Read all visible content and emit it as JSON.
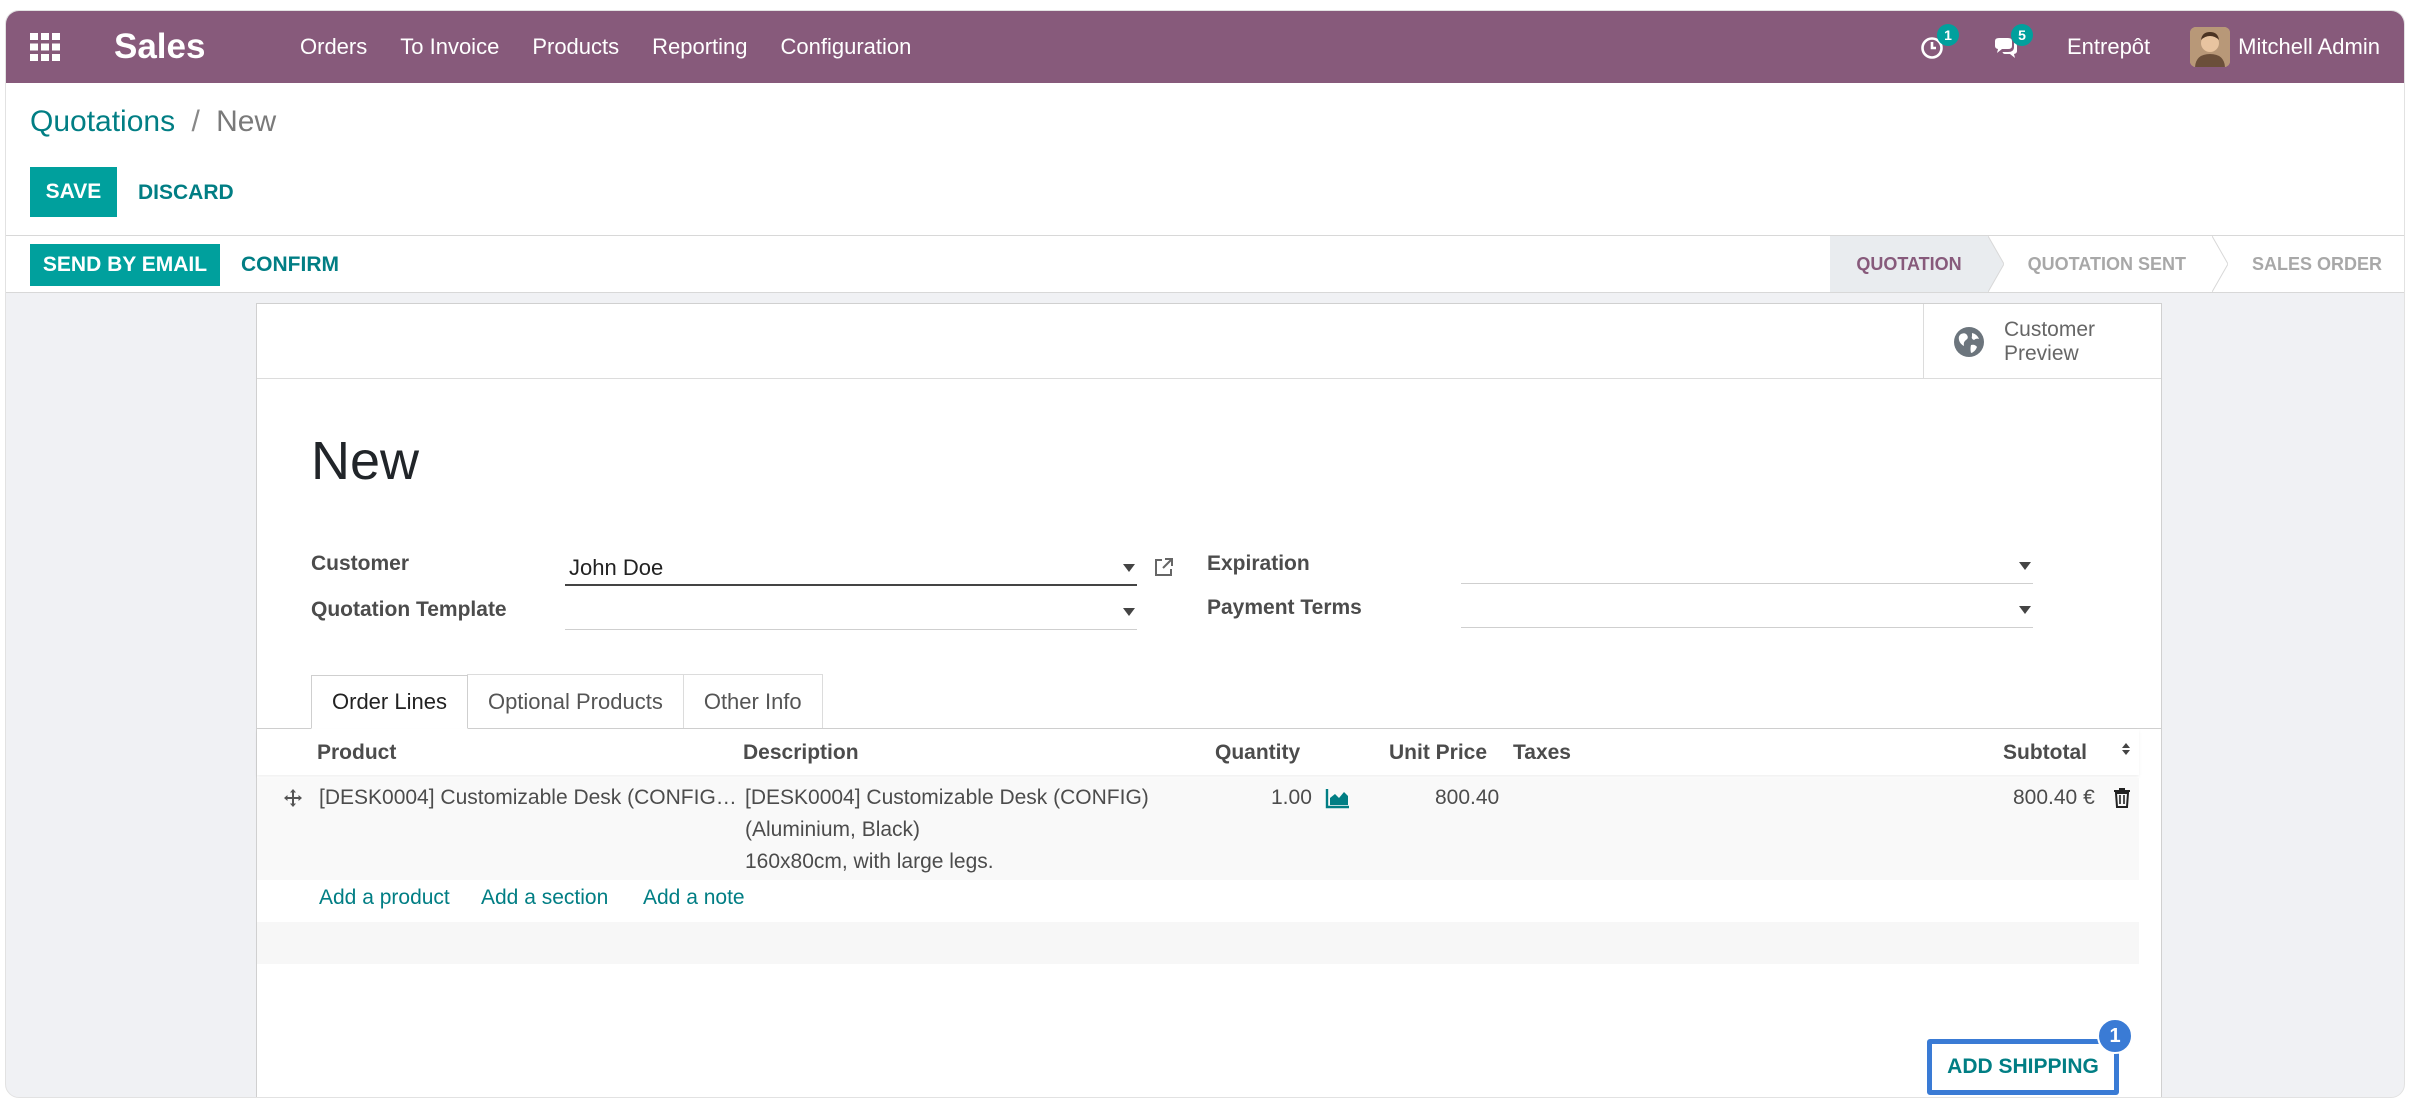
{
  "navbar": {
    "app_name": "Sales",
    "menu": [
      "Orders",
      "To Invoice",
      "Products",
      "Reporting",
      "Configuration"
    ],
    "activity_count": "1",
    "messages_count": "5",
    "company": "Entrepôt",
    "user": "Mitchell Admin",
    "color": "#875a7b"
  },
  "breadcrumb": {
    "parent": "Quotations",
    "separator": "/",
    "current": "New"
  },
  "actions": {
    "save": "SAVE",
    "discard": "DISCARD",
    "send_by_email": "SEND BY EMAIL",
    "confirm": "CONFIRM"
  },
  "status": {
    "steps": [
      "QUOTATION",
      "QUOTATION SENT",
      "SALES ORDER"
    ],
    "active": "QUOTATION"
  },
  "stat_button": {
    "label_line1": "Customer",
    "label_line2": "Preview"
  },
  "form": {
    "title": "New",
    "customer_label": "Customer",
    "customer_value": "John Doe",
    "template_label": "Quotation Template",
    "template_value": "",
    "expiration_label": "Expiration",
    "expiration_value": "",
    "payment_terms_label": "Payment Terms",
    "payment_terms_value": ""
  },
  "tabs": [
    "Order Lines",
    "Optional Products",
    "Other Info"
  ],
  "table": {
    "headers": {
      "product": "Product",
      "description": "Description",
      "quantity": "Quantity",
      "unit_price": "Unit Price",
      "taxes": "Taxes",
      "subtotal": "Subtotal"
    },
    "rows": [
      {
        "product": "[DESK0004] Customizable Desk (CONFIG…",
        "description_lines": [
          "[DESK0004] Customizable Desk (CONFIG)",
          "(Aluminium, Black)",
          "160x80cm, with large legs."
        ],
        "quantity": "1.00",
        "unit_price": "800.40",
        "taxes": "",
        "subtotal": "800.40 €"
      }
    ],
    "add_product": "Add a product",
    "add_section": "Add a section",
    "add_note": "Add a note"
  },
  "shipping": {
    "label": "ADD SHIPPING",
    "step_badge": "1"
  },
  "colors": {
    "primary": "#00a09d",
    "link": "#017e84",
    "highlight": "#3a7bd5"
  }
}
